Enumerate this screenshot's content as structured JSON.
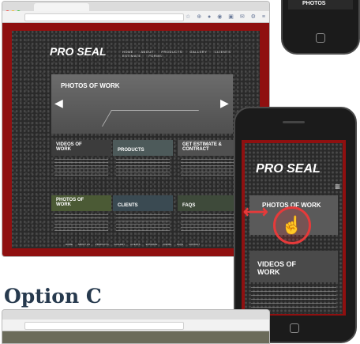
{
  "site": {
    "logo": "PRO SEAL",
    "nav": [
      "HOME",
      "ABOUT",
      "PRODUCTS",
      "GALLERY",
      "CLIENTS",
      "ESTIMATE",
      "FORMS"
    ],
    "hero_title": "PHOTOS OF WORK",
    "tiles": [
      {
        "title": "VIDEOS OF WORK"
      },
      {
        "title": "PRODUCTS"
      },
      {
        "title": "GET ESTIMATE & CONTRACT"
      },
      {
        "title": "PHOTOS OF WORK"
      },
      {
        "title": "CLIENTS"
      },
      {
        "title": "FAQS"
      }
    ],
    "footer": [
      "HOME",
      "ABOUT US",
      "PRODUCTS",
      "GALLERY",
      "CLIENTS",
      "ESTIMATE",
      "FORMS",
      "FAQS",
      "CONTACT"
    ]
  },
  "phone": {
    "logo": "PRO SEAL",
    "hero_title": "PHOTOS OF WORK",
    "tile_title": "VIDEOS OF WORK"
  },
  "top_phone_text": "PHOTOS",
  "option_label": "Option C",
  "colors": {
    "brand_red": "#8f1010",
    "asphalt": "#2a2a2a",
    "option_text": "#273a4e",
    "swipe_arrow": "#e63a3a"
  }
}
